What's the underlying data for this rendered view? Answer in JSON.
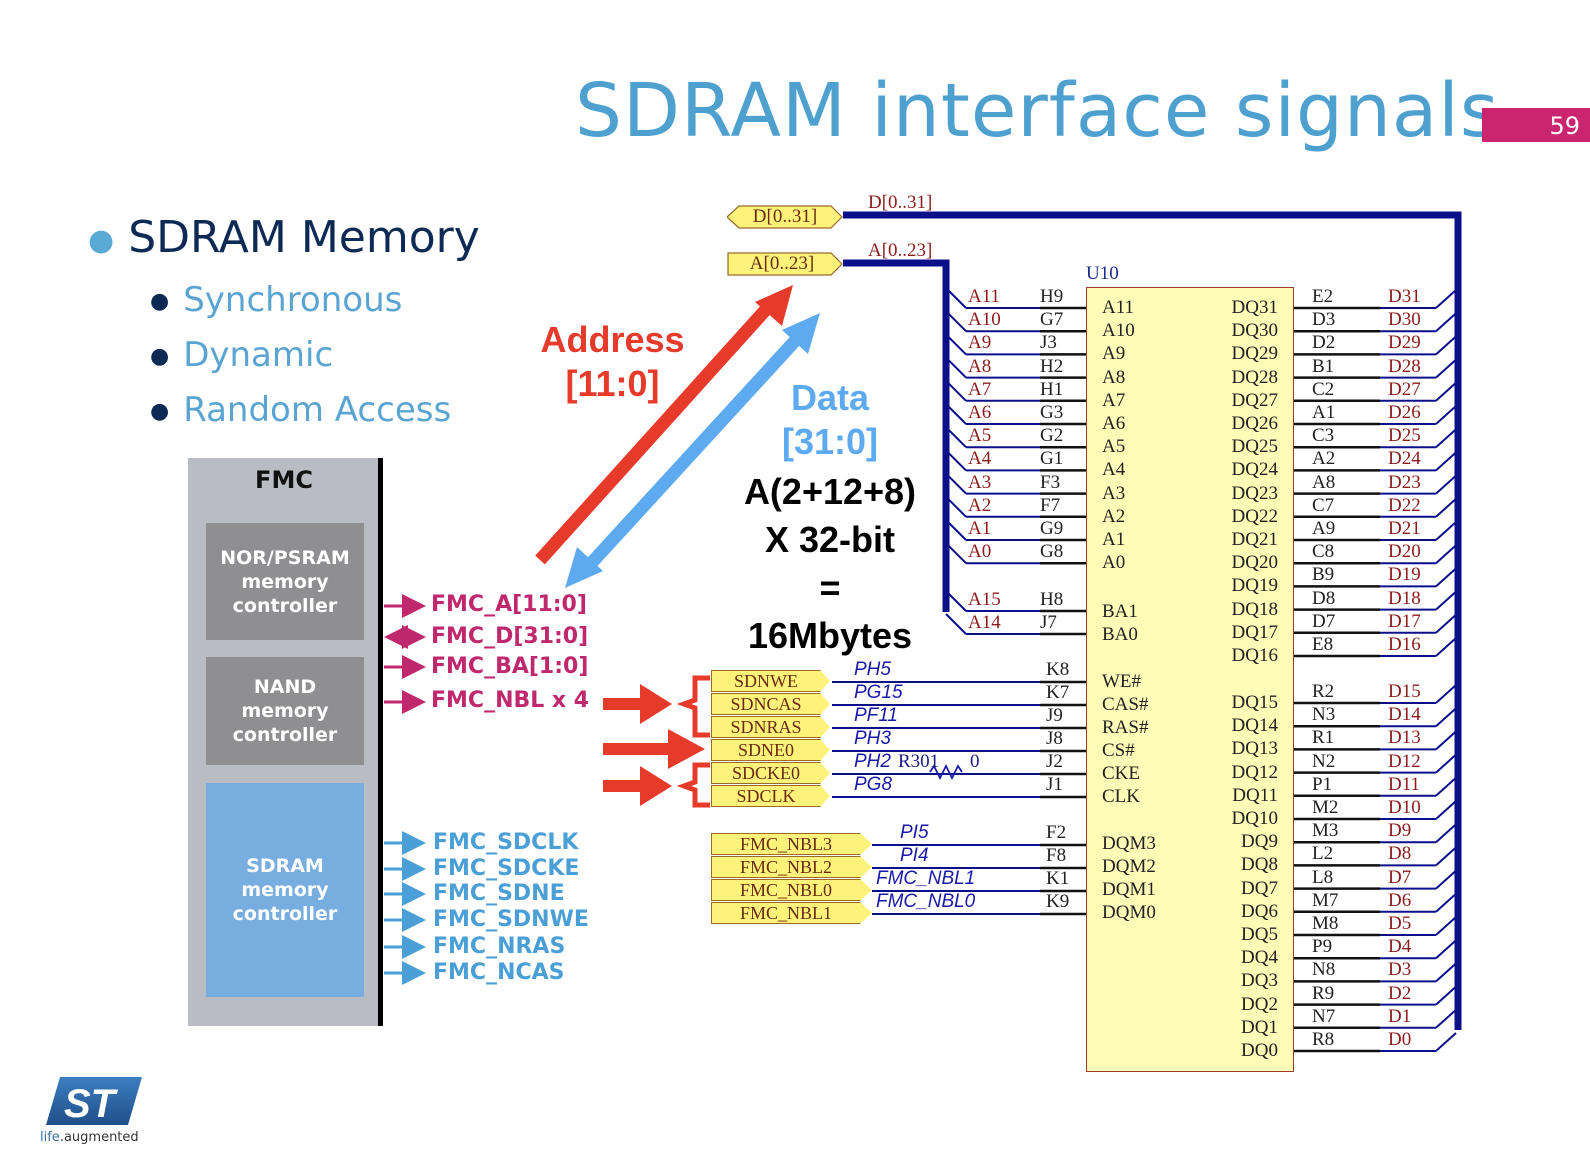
{
  "slide": {
    "title": "SDRAM interface signals",
    "page_number": "59",
    "accent_color": "#c9266f",
    "title_color": "#4ea0cf"
  },
  "bullets": {
    "main": "SDRAM Memory",
    "sub": [
      "Synchronous",
      "Dynamic",
      "Random Access"
    ]
  },
  "fmc": {
    "label": "FMC",
    "controllers": [
      {
        "lines": [
          "NOR/PSRAM",
          "memory",
          "controller"
        ]
      },
      {
        "lines": [
          "NAND",
          "memory",
          "controller"
        ]
      },
      {
        "lines": [
          "SDRAM",
          "memory",
          "controller"
        ]
      }
    ],
    "pink_signals": [
      "FMC_A[11:0]",
      "FMC_D[31:0]",
      "FMC_BA[1:0]",
      "FMC_NBL x 4"
    ],
    "blue_signals": [
      "FMC_SDCLK",
      "FMC_SDCKE",
      "FMC_SDNE",
      "FMC_SDNWE",
      "FMC_NRAS",
      "FMC_NCAS"
    ]
  },
  "annotations": {
    "address_line1": "Address",
    "address_line2": "[11:0]",
    "data_line1": "Data",
    "data_line2": "[31:0]",
    "formula": [
      "A(2+12+8)",
      "X 32-bit",
      "=",
      "16Mbytes"
    ]
  },
  "schematic": {
    "bus_ports": [
      {
        "label": "D[0..31]",
        "net": "D[0..31]"
      },
      {
        "label": "A[0..23]",
        "net": "A[0..23]"
      }
    ],
    "chip_ref": "U10",
    "address_pins": [
      {
        "net": "A11",
        "ball": "H9",
        "pin": "A11"
      },
      {
        "net": "A10",
        "ball": "G7",
        "pin": "A10"
      },
      {
        "net": "A9",
        "ball": "J3",
        "pin": "A9"
      },
      {
        "net": "A8",
        "ball": "H2",
        "pin": "A8"
      },
      {
        "net": "A7",
        "ball": "H1",
        "pin": "A7"
      },
      {
        "net": "A6",
        "ball": "G3",
        "pin": "A6"
      },
      {
        "net": "A5",
        "ball": "G2",
        "pin": "A5"
      },
      {
        "net": "A4",
        "ball": "G1",
        "pin": "A4"
      },
      {
        "net": "A3",
        "ball": "F3",
        "pin": "A3"
      },
      {
        "net": "A2",
        "ball": "F7",
        "pin": "A2"
      },
      {
        "net": "A1",
        "ball": "G9",
        "pin": "A1"
      },
      {
        "net": "A0",
        "ball": "G8",
        "pin": "A0"
      }
    ],
    "bank_pins": [
      {
        "net": "A15",
        "ball": "H8",
        "pin": "BA1"
      },
      {
        "net": "A14",
        "ball": "J7",
        "pin": "BA0"
      }
    ],
    "control_pins": [
      {
        "port": "SDNWE",
        "mcu": "PH5",
        "ball": "K8",
        "pin": "WE#"
      },
      {
        "port": "SDNCAS",
        "mcu": "PG15",
        "ball": "K7",
        "pin": "CAS#"
      },
      {
        "port": "SDNRAS",
        "mcu": "PF11",
        "ball": "J9",
        "pin": "RAS#"
      },
      {
        "port": "SDNE0",
        "mcu": "PH3",
        "ball": "J8",
        "pin": "CS#"
      },
      {
        "port": "SDCKE0",
        "mcu": "PH2",
        "ball": "J2",
        "pin": "CKE"
      },
      {
        "port": "SDCLK",
        "mcu": "PG8",
        "ball": "J1",
        "pin": "CLK"
      }
    ],
    "resistor": {
      "ref": "R301",
      "value": "0"
    },
    "mask_pins": [
      {
        "port": "FMC_NBL3",
        "mcu": "PI5",
        "ball": "F2",
        "pin": "DQM3"
      },
      {
        "port": "FMC_NBL2",
        "mcu": "PI4",
        "ball": "F8",
        "pin": "DQM2"
      },
      {
        "port": "FMC_NBL0",
        "mcu": "FMC_NBL1",
        "ball": "K1",
        "pin": "DQM1"
      },
      {
        "port": "FMC_NBL1",
        "mcu": "FMC_NBL0",
        "ball": "K9",
        "pin": "DQM0"
      }
    ],
    "data_pins_high": [
      {
        "pin": "DQ31",
        "ball": "E2",
        "net": "D31"
      },
      {
        "pin": "DQ30",
        "ball": "D3",
        "net": "D30"
      },
      {
        "pin": "DQ29",
        "ball": "D2",
        "net": "D29"
      },
      {
        "pin": "DQ28",
        "ball": "B1",
        "net": "D28"
      },
      {
        "pin": "DQ27",
        "ball": "C2",
        "net": "D27"
      },
      {
        "pin": "DQ26",
        "ball": "A1",
        "net": "D26"
      },
      {
        "pin": "DQ25",
        "ball": "C3",
        "net": "D25"
      },
      {
        "pin": "DQ24",
        "ball": "A2",
        "net": "D24"
      },
      {
        "pin": "DQ23",
        "ball": "A8",
        "net": "D23"
      },
      {
        "pin": "DQ22",
        "ball": "C7",
        "net": "D22"
      },
      {
        "pin": "DQ21",
        "ball": "A9",
        "net": "D21"
      },
      {
        "pin": "DQ20",
        "ball": "C8",
        "net": "D20"
      },
      {
        "pin": "DQ19",
        "ball": "B9",
        "net": "D19"
      },
      {
        "pin": "DQ18",
        "ball": "D8",
        "net": "D18"
      },
      {
        "pin": "DQ17",
        "ball": "D7",
        "net": "D17"
      },
      {
        "pin": "DQ16",
        "ball": "E8",
        "net": "D16"
      }
    ],
    "data_pins_low": [
      {
        "pin": "DQ15",
        "ball": "R2",
        "net": "D15"
      },
      {
        "pin": "DQ14",
        "ball": "N3",
        "net": "D14"
      },
      {
        "pin": "DQ13",
        "ball": "R1",
        "net": "D13"
      },
      {
        "pin": "DQ12",
        "ball": "N2",
        "net": "D12"
      },
      {
        "pin": "DQ11",
        "ball": "P1",
        "net": "D11"
      },
      {
        "pin": "DQ10",
        "ball": "M2",
        "net": "D10"
      },
      {
        "pin": "DQ9",
        "ball": "M3",
        "net": "D9"
      },
      {
        "pin": "DQ8",
        "ball": "L2",
        "net": "D8"
      },
      {
        "pin": "DQ7",
        "ball": "L8",
        "net": "D7"
      },
      {
        "pin": "DQ6",
        "ball": "M7",
        "net": "D6"
      },
      {
        "pin": "DQ5",
        "ball": "M8",
        "net": "D5"
      },
      {
        "pin": "DQ4",
        "ball": "P9",
        "net": "D4"
      },
      {
        "pin": "DQ3",
        "ball": "N8",
        "net": "D3"
      },
      {
        "pin": "DQ2",
        "ball": "R9",
        "net": "D2"
      },
      {
        "pin": "DQ1",
        "ball": "N7",
        "net": "D1"
      },
      {
        "pin": "DQ0",
        "ball": "R8",
        "net": "D0"
      }
    ]
  },
  "logo": {
    "mark": "ST",
    "tagline_a": "life",
    "tagline_b": ".augmented"
  },
  "colors": {
    "address_arrow": "#e63a2a",
    "data_arrow": "#5eaaf0",
    "bus_wire": "#0c0f8a",
    "pink_signal": "#c0286e",
    "blue_signal": "#4a9fd6"
  }
}
